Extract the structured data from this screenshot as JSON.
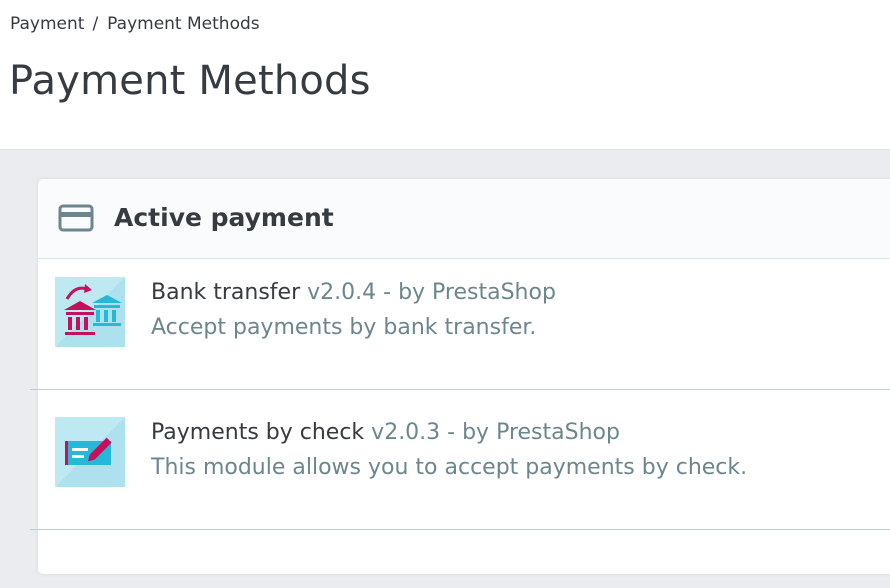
{
  "breadcrumb": {
    "items": [
      "Payment",
      "Payment Methods"
    ],
    "separator": "/"
  },
  "page": {
    "title": "Payment Methods"
  },
  "active_payment": {
    "title": "Active payment",
    "icon": "credit-card-icon",
    "modules": [
      {
        "name": "Bank transfer",
        "meta": "v2.0.4 - by PrestaShop",
        "description": "Accept payments by bank transfer.",
        "icon": "bank-transfer-icon"
      },
      {
        "name": "Payments by check",
        "meta": "v2.0.3 - by PrestaShop",
        "description": "This module allows you to accept payments by check.",
        "icon": "check-payment-icon"
      }
    ]
  },
  "colors": {
    "text": "#363a41",
    "muted": "#6c868e",
    "accent": "#c5105b",
    "icon_blue": "#25b9d7",
    "tile_bg": "#bee9f3",
    "page_bg": "#eaecef"
  }
}
